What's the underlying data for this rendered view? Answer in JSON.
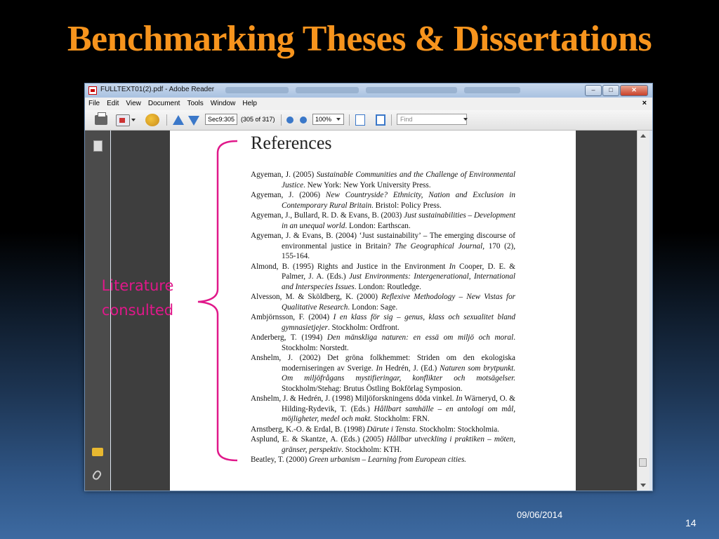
{
  "slide": {
    "title": "Benchmarking Theses & Dissertations",
    "annotation_line1": "Literature",
    "annotation_line2": "consulted",
    "date": "09/06/2014",
    "page_number": "14"
  },
  "window": {
    "title": "FULLTEXT01(2).pdf - Adobe Reader",
    "minimize_label": "–",
    "maximize_label": "□",
    "close_label": "✕"
  },
  "menu": {
    "items": [
      "File",
      "Edit",
      "View",
      "Document",
      "Tools",
      "Window",
      "Help"
    ],
    "close_doc": "×"
  },
  "toolbar": {
    "page_value": "Sec9:305",
    "page_of": "(305 of 317)",
    "zoom_value": "100%",
    "find_placeholder": "Find"
  },
  "document": {
    "heading": "References",
    "references": [
      [
        [
          "Agyeman, J. (2005) ",
          false
        ],
        [
          "Sustainable Communities and the Challenge of Environmental Justice",
          true
        ],
        [
          ". New York: New York University Press.",
          false
        ]
      ],
      [
        [
          "Agyeman, J. (2006) ",
          false
        ],
        [
          "New Countryside? Ethnicity, Nation and Exclusion in Contemporary Rural Britain",
          true
        ],
        [
          ". Bristol: Policy Press.",
          false
        ]
      ],
      [
        [
          "Agyeman, J., Bullard, R. D. & Evans, B. (2003) ",
          false
        ],
        [
          "Just sustainabilities – Development in an unequal world",
          true
        ],
        [
          ". London: Earthscan.",
          false
        ]
      ],
      [
        [
          "Agyeman, J. & Evans, B. (2004) ‘Just sustainability’ – The emerging discourse of environmental justice in Britain? ",
          false
        ],
        [
          "The Geographical Journal,",
          true
        ],
        [
          " 170 (2), 155-164.",
          false
        ]
      ],
      [
        [
          "Almond, B. (1995) Rights and Justice in the Environment ",
          false
        ],
        [
          "In",
          true
        ],
        [
          " Cooper, D. E. & Palmer, J. A. (Eds.) ",
          false
        ],
        [
          "Just Environments: Intergenerational, International and Interspecies Issues",
          true
        ],
        [
          ". London: Routledge.",
          false
        ]
      ],
      [
        [
          "Alvesson, M. & Sköldberg, K. (2000) ",
          false
        ],
        [
          "Reflexive Methodology – New Vistas for Qualitative Research",
          true
        ],
        [
          ". London: Sage.",
          false
        ]
      ],
      [
        [
          "Ambjörnsson, F. (2004) ",
          false
        ],
        [
          "I en klass för sig – genus, klass och sexualitet bland gymnasietjejer",
          true
        ],
        [
          ". Stockholm: Ordfront.",
          false
        ]
      ],
      [
        [
          "Anderberg, T. (1994) ",
          false
        ],
        [
          "Den mänskliga naturen: en essä om miljö och moral",
          true
        ],
        [
          ". Stockholm: Norstedt.",
          false
        ]
      ],
      [
        [
          "Anshelm, J. (2002) Det gröna folkhemmet: Striden om den ekologiska moderniseringen av Sverige. ",
          false
        ],
        [
          "In",
          true
        ],
        [
          " Hedrén, J. (Ed.) ",
          false
        ],
        [
          "Naturen som brytpunkt. Om miljöfrågans mystifieringar, konflikter och motsägelser.",
          true
        ],
        [
          " Stockholm/Stehag: Brutus Östling Bokförlag Symposion.",
          false
        ]
      ],
      [
        [
          "Anshelm, J. & Hedrén, J. (1998) Miljöforskningens döda vinkel. ",
          false
        ],
        [
          "In",
          true
        ],
        [
          " Wärneryd, O. & Hilding-Rydevik, T. (Eds.) ",
          false
        ],
        [
          "Hållbart samhälle – en antologi om mål, möjligheter, medel och makt.",
          true
        ],
        [
          " Stockholm: FRN.",
          false
        ]
      ],
      [
        [
          "Arnstberg, K.-O. & Erdal, B. (1998) ",
          false
        ],
        [
          "Därute i Tensta",
          true
        ],
        [
          ". Stockholm: Stockholmia.",
          false
        ]
      ],
      [
        [
          "Asplund, E. & Skantze, A. (Eds.) (2005) ",
          false
        ],
        [
          "Hållbar utveckling i praktiken – möten, gränser, perspektiv",
          true
        ],
        [
          ". Stockholm: KTH.",
          false
        ]
      ],
      [
        [
          "Beatley, T. (2000) ",
          false
        ],
        [
          "Green urbanism – Learning from European cities.",
          true
        ]
      ]
    ]
  }
}
